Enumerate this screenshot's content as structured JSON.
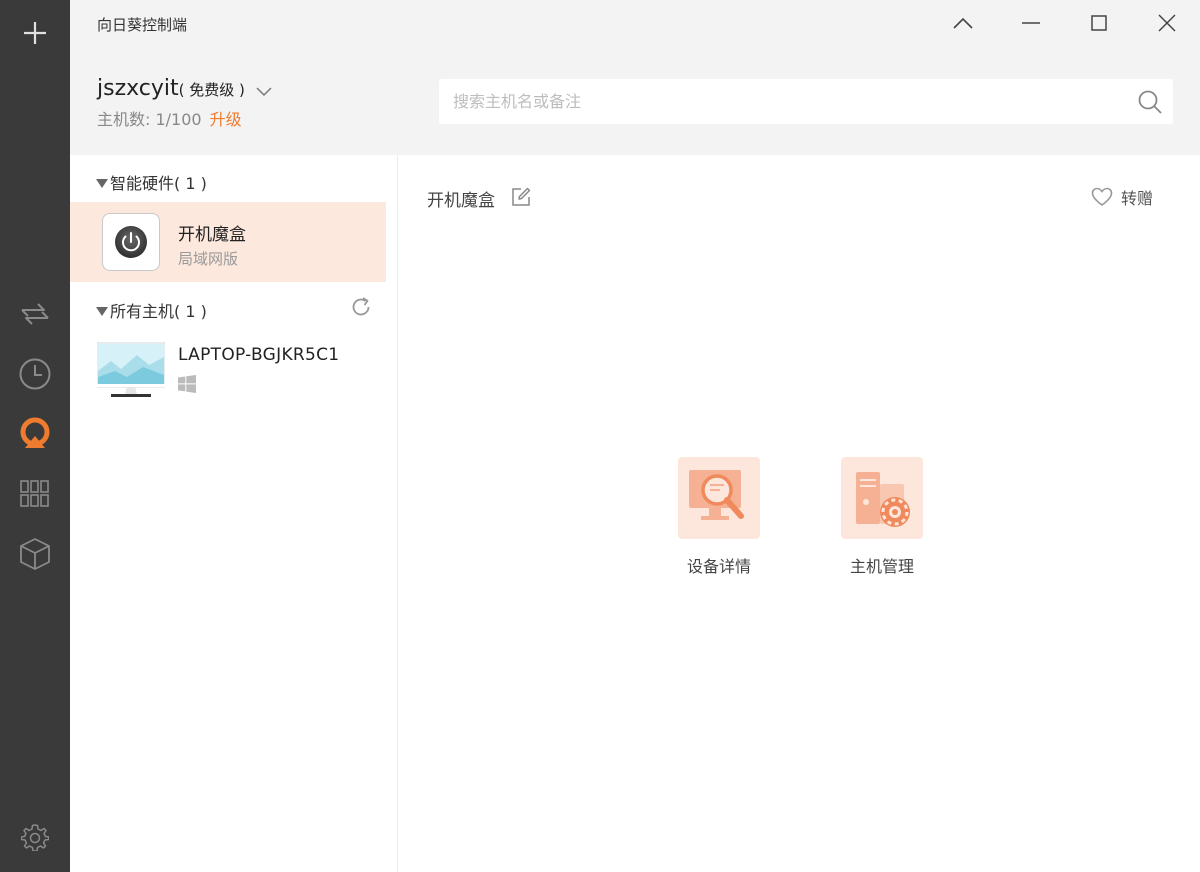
{
  "app": {
    "title": "向日葵控制端"
  },
  "account": {
    "username": "jszxcyit",
    "level": "( 免费级 )",
    "host_count_label": "主机数: 1/100",
    "upgrade_label": "升级"
  },
  "search": {
    "placeholder": "搜索主机名或备注"
  },
  "groups": {
    "hardware": {
      "header": "智能硬件( 1 )",
      "item": {
        "name": "开机魔盒",
        "subtitle": "局域网版"
      }
    },
    "hosts": {
      "header": "所有主机( 1 )",
      "item": {
        "name": "LAPTOP-BGJKR5C1"
      }
    }
  },
  "detail": {
    "title": "开机魔盒",
    "gift_label": "转赠",
    "actions": [
      {
        "label": "设备详情"
      },
      {
        "label": "主机管理"
      }
    ]
  },
  "colors": {
    "accent": "#ef7b2e",
    "rail_bg": "#3a3a3a",
    "selected_bg": "#fde8de",
    "header_bg": "#f3f3f3"
  },
  "icons": {
    "rail": [
      "plus-icon",
      "transfer-arrows-icon",
      "clock-icon",
      "remote-control-logo-icon",
      "grid-apps-icon",
      "cube-icon",
      "gear-icon"
    ],
    "window": [
      "collapse-icon",
      "minimize-icon",
      "maximize-icon",
      "close-icon"
    ]
  }
}
